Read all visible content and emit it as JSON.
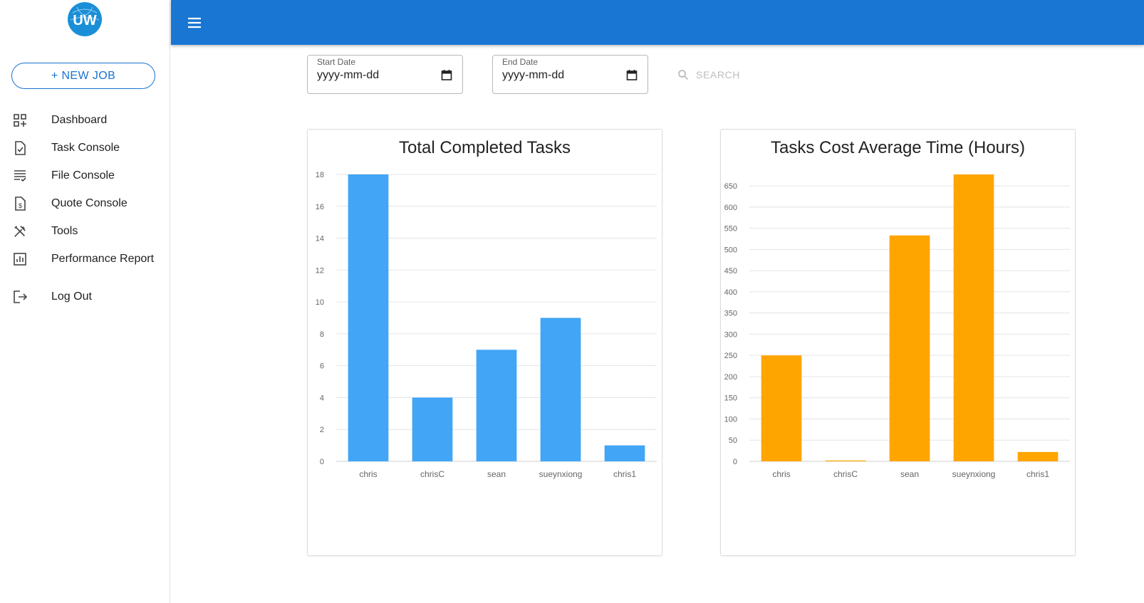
{
  "sidebar": {
    "logo_text": "UW",
    "new_job_label": "+ NEW JOB",
    "items": [
      {
        "label": "Dashboard",
        "icon": "dashboard-icon"
      },
      {
        "label": "Task Console",
        "icon": "task-check-icon"
      },
      {
        "label": "File Console",
        "icon": "list-check-icon"
      },
      {
        "label": "Quote Console",
        "icon": "dollar-document-icon"
      },
      {
        "label": "Tools",
        "icon": "tools-icon"
      },
      {
        "label": "Performance Report",
        "icon": "bar-chart-icon"
      },
      {
        "label": "Log Out",
        "icon": "logout-icon"
      }
    ]
  },
  "header": {
    "menu_icon": "hamburger-menu-icon",
    "color": "#1976d2"
  },
  "filters": {
    "start_date": {
      "label": "Start Date",
      "value": "yyyy-mm-dd"
    },
    "end_date": {
      "label": "End Date",
      "value": "yyyy-mm-dd"
    },
    "search_label": "SEARCH"
  },
  "chart_data": [
    {
      "type": "bar",
      "title": "Total Completed Tasks",
      "categories": [
        "chris",
        "chrisC",
        "sean",
        "sueynxiong",
        "chris1"
      ],
      "values": [
        18,
        4,
        7,
        9,
        1
      ],
      "ylim": [
        0,
        18
      ],
      "yticks": [
        0,
        2,
        4,
        6,
        8,
        10,
        12,
        14,
        16,
        18
      ],
      "color": "#42a5f5",
      "grid": true
    },
    {
      "type": "bar",
      "title": "Tasks Cost Average Time (Hours)",
      "categories": [
        "chris",
        "chrisC",
        "sean",
        "sueynxiong",
        "chris1"
      ],
      "values": [
        250,
        2,
        533,
        677,
        22
      ],
      "ylim": [
        0,
        677
      ],
      "yticks": [
        0,
        50,
        100,
        150,
        200,
        250,
        300,
        350,
        400,
        450,
        500,
        550,
        600,
        650
      ],
      "color": "#ffa500",
      "grid": true
    }
  ]
}
